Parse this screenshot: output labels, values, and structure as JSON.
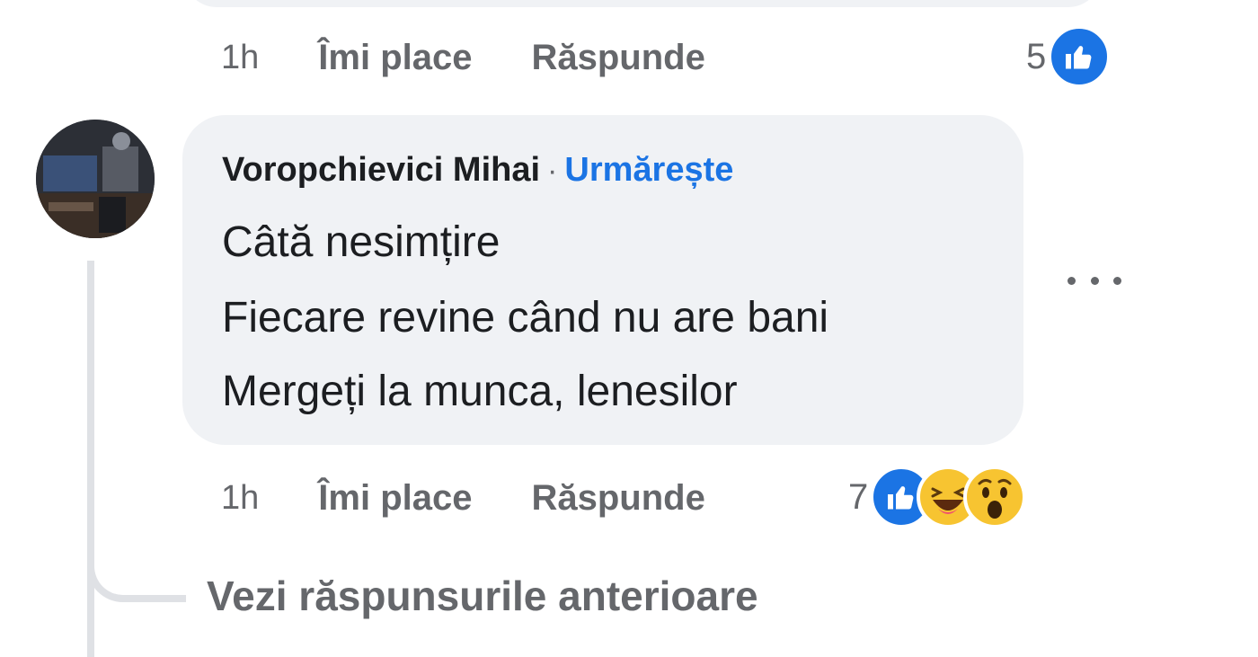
{
  "previous_comment": {
    "time": "1h",
    "like_label": "Îmi place",
    "reply_label": "Răspunde",
    "reaction_count": "5",
    "reaction_icons": [
      "like-icon"
    ]
  },
  "comment": {
    "author": "Voropchievici Mihai",
    "separator": "·",
    "follow_label": "Urmărește",
    "lines": [
      "Câtă nesimțire",
      "Fiecare revine când nu are bani",
      "Mergeți la munca, lenesilor"
    ],
    "time": "1h",
    "like_label": "Îmi place",
    "reply_label": "Răspunde",
    "reaction_count": "7",
    "reaction_icons": [
      "like-icon",
      "haha-icon",
      "wow-icon"
    ],
    "more_icon": "more-options-icon"
  },
  "thread": {
    "see_previous_replies": "Vezi răspunsurile anterioare"
  },
  "colors": {
    "bubble_bg": "#f0f2f5",
    "link_blue": "#1b74e4",
    "muted_text": "#65676b",
    "reaction_yellow": "#f7c431"
  }
}
